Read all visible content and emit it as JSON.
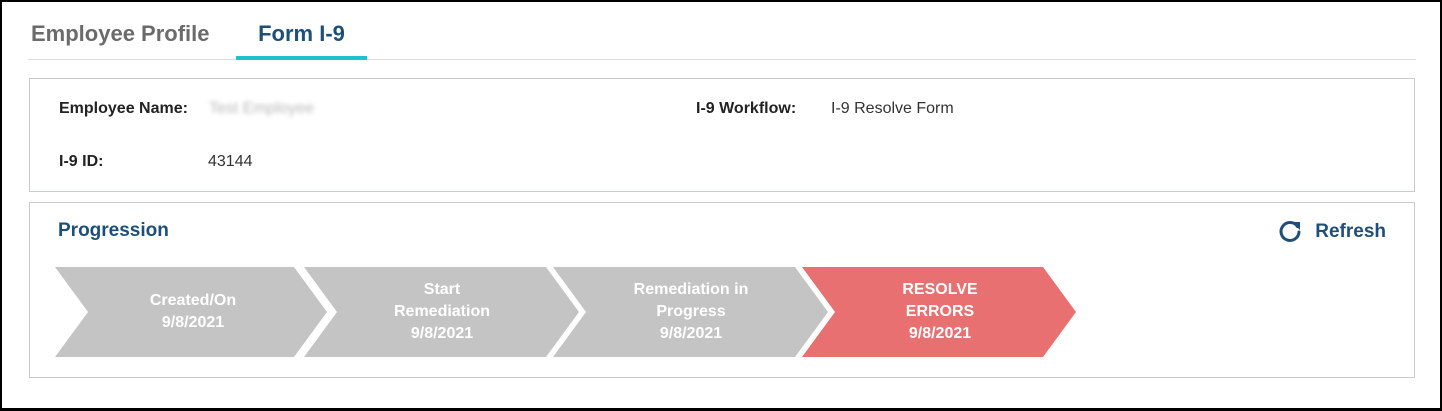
{
  "tabs": [
    {
      "label": "Employee Profile",
      "active": false
    },
    {
      "label": "Form I-9",
      "active": true
    }
  ],
  "info": {
    "employee_name_label": "Employee Name:",
    "employee_name_value": "Test Employee",
    "i9_id_label": "I-9 ID:",
    "i9_id_value": "43144",
    "workflow_label": "I-9 Workflow:",
    "workflow_value": "I-9 Resolve Form"
  },
  "progression": {
    "title": "Progression",
    "refresh_label": "Refresh",
    "refresh_icon": "refresh-icon",
    "steps": [
      {
        "lines": [
          "Created/On",
          "9/8/2021"
        ],
        "state": "done"
      },
      {
        "lines": [
          "Start",
          "Remediation",
          "9/8/2021"
        ],
        "state": "done"
      },
      {
        "lines": [
          "Remediation in",
          "Progress",
          "9/8/2021"
        ],
        "state": "done"
      },
      {
        "lines": [
          "RESOLVE",
          "ERRORS",
          "9/8/2021"
        ],
        "state": "current"
      }
    ]
  },
  "colors": {
    "accent_underline": "#1fc0cf",
    "title_blue": "#1d4f7a",
    "step_done": "#c4c4c4",
    "step_current": "#e87070"
  }
}
